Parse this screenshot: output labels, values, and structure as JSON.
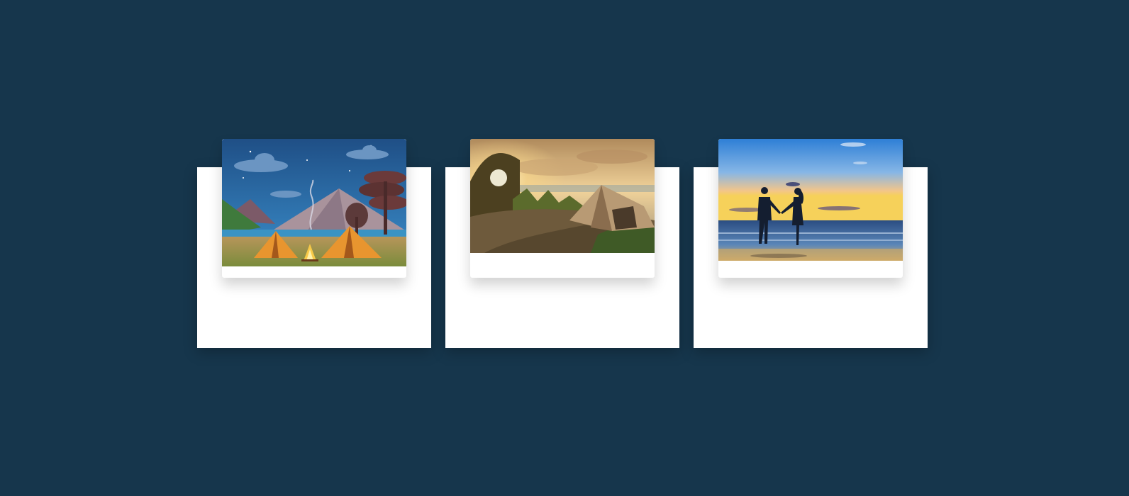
{
  "gallery": {
    "cards": [
      {
        "image": "camping-illustration-image"
      },
      {
        "image": "tent-sunset-photo"
      },
      {
        "image": "beach-couple-sunset-photo"
      }
    ]
  },
  "colors": {
    "background": "#16364c",
    "card": "#ffffff"
  }
}
